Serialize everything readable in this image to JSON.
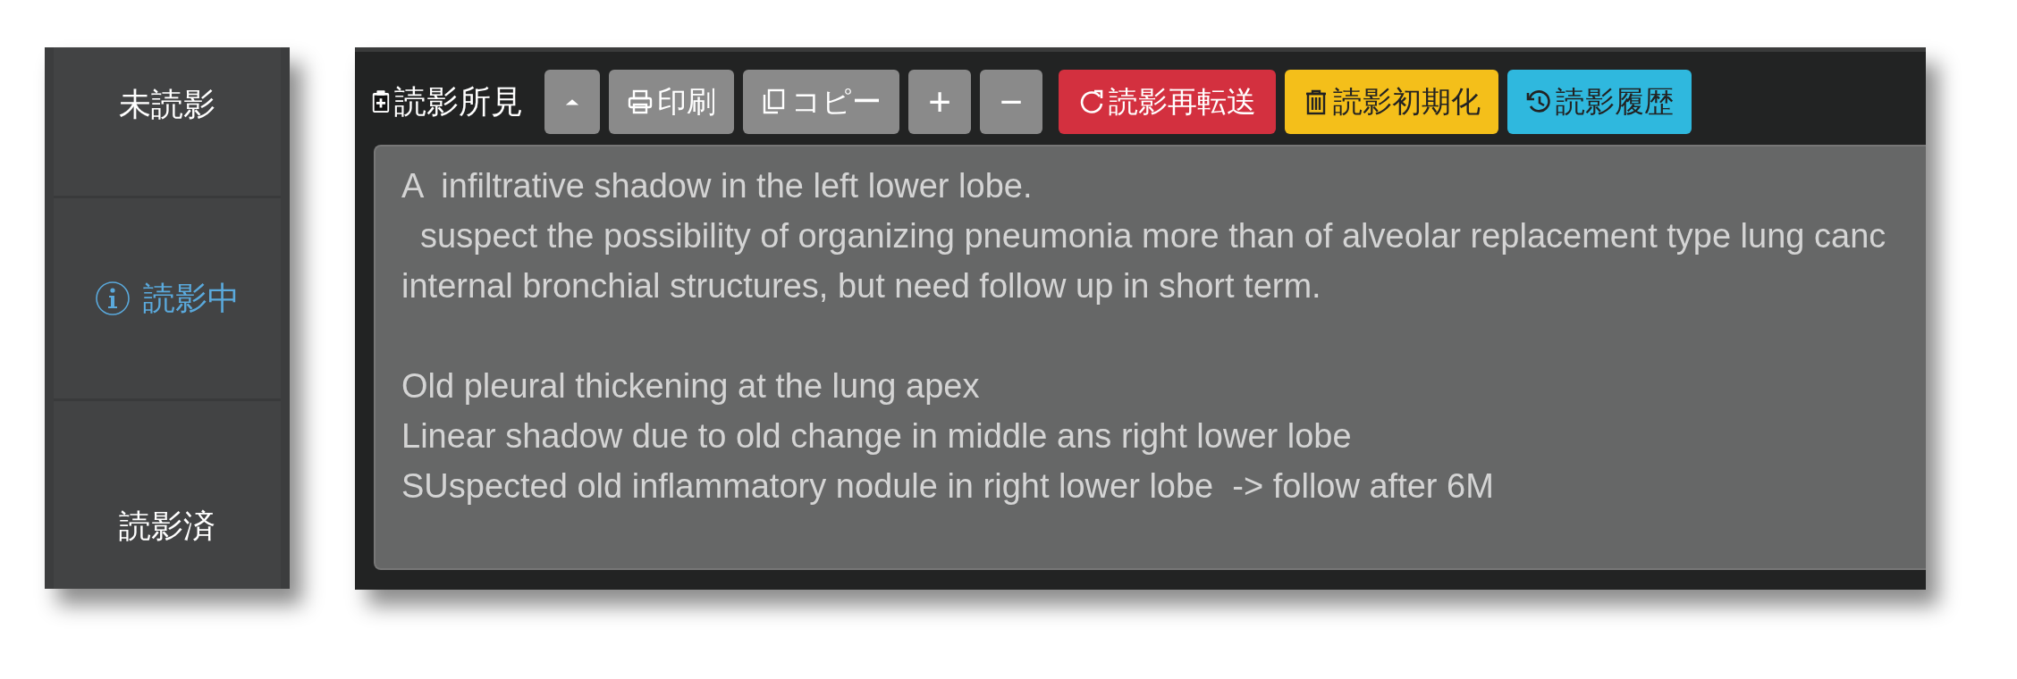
{
  "sidebar": {
    "items": [
      {
        "label": "未読影",
        "selected": false
      },
      {
        "label": "読影中",
        "selected": true
      },
      {
        "label": "読影済",
        "selected": false
      }
    ]
  },
  "toolbar": {
    "title": "読影所見",
    "buttons": [
      {
        "kind": "collapse"
      },
      {
        "kind": "print",
        "label": "印刷"
      },
      {
        "kind": "copy",
        "label": "コピー"
      },
      {
        "kind": "plus",
        "label": "+"
      },
      {
        "kind": "minus",
        "label": "−"
      },
      {
        "kind": "resend",
        "label": "読影再転送"
      },
      {
        "kind": "reset",
        "label": "読影初期化"
      },
      {
        "kind": "history",
        "label": "読影履歴"
      }
    ]
  },
  "report": {
    "paragraphs": [
      [
        "A  infiltrative shadow in the left lower lobe.",
        "  suspect the possibility of organizing pneumonia more than of alveolar replacement type lung canc",
        "internal bronchial structures, but need follow up in short term."
      ],
      [
        "Old pleural thickening at the lung apex",
        "Linear shadow due to old change in middle ans right lower lobe",
        "SUspected old inflammatory nodule in right lower lobe  -> follow after 6M"
      ]
    ]
  }
}
